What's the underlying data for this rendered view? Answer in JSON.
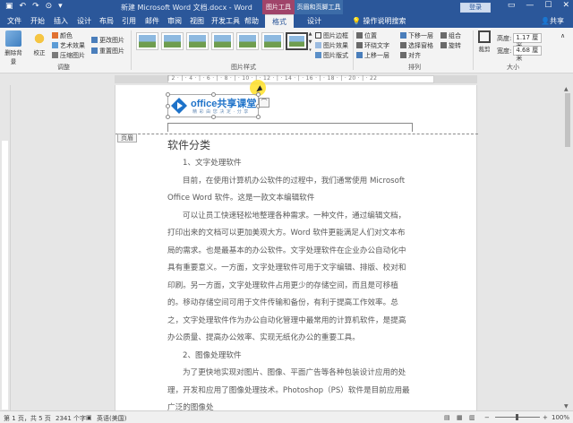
{
  "titlebar": {
    "doc_title": "新建 Microsoft Word 文档.docx - Word",
    "context_tab_1": "图片工具",
    "context_tab_2": "页眉和页脚工具",
    "login_label": "登录"
  },
  "tabs": [
    {
      "label": "文件"
    },
    {
      "label": "开始"
    },
    {
      "label": "插入"
    },
    {
      "label": "设计"
    },
    {
      "label": "布局"
    },
    {
      "label": "引用"
    },
    {
      "label": "邮件"
    },
    {
      "label": "审阅"
    },
    {
      "label": "视图"
    },
    {
      "label": "开发工具"
    },
    {
      "label": "帮助"
    },
    {
      "label": "格式"
    },
    {
      "label": "设计"
    }
  ],
  "tellme": "操作说明搜索",
  "share": "共享",
  "ribbon": {
    "remove_bg": "删除背景",
    "corrections": "校正",
    "color": "颜色",
    "artistic": "艺术效果",
    "compress": "压缩图片",
    "change_pic": "更改图片",
    "reset_pic": "重置图片",
    "group_adjust": "调整",
    "group_styles": "图片样式",
    "pic_border": "图片边框",
    "pic_effects": "图片效果",
    "pic_layout": "图片版式",
    "position": "位置",
    "wrap_text": "环绕文字",
    "bring_forward": "上移一层",
    "send_backward": "下移一层",
    "selection_pane": "选择窗格",
    "align": "对齐",
    "group_obj": "组合",
    "rotate": "旋转",
    "group_arrange": "排列",
    "crop": "裁剪",
    "height_label": "高度:",
    "height_value": "1.17 厘米",
    "width_label": "宽度:",
    "width_value": "4.68 厘米",
    "group_size": "大小"
  },
  "document": {
    "header_tag": "页眉",
    "logo_text": "office共享课堂",
    "logo_sub": "精 彩 由 您 决 定 · 分 享",
    "heading": "软件分类",
    "sub1": "1、文字处理软件",
    "p1": "目前，在使用计算机办公软件的过程中，我们通常使用 Microsoft Office Word 软件。这是一款文本编辑软件",
    "p2": "可以让员工快速轻松地整理各种需求。一种文件，通过编辑文档，打印出来的文档可以更加美观大方。Word 软件更能满足人们对文本布局的需求。也是最基本的办公软件。文字处理软件在企业办公自动化中具有重要意义。一方面，文字处理软件可用于文字编辑、排版、校对和印刷。另一方面，文字处理软件占用更少的存储空间，而且是可移植的。移动存储空间可用于文件传输和备份，有利于提高工作效率。总之，文字处理软件作为办公自动化管理中最常用的计算机软件，是提高办公质量、提高办公效率、实现无纸化办公的重要工具。",
    "sub2": "2、图像处理软件",
    "p3": "为了更快地实现对图片、图像、平面广告等各种包装设计应用的处理，开发和应用了图像处理技术。Photoshop（PS）软件是目前应用最广泛的图像处"
  },
  "statusbar": {
    "pages": "第 1 页，共 5 页",
    "words": "2341 个字",
    "lang": "英语(美国)",
    "zoom": "100%"
  },
  "colors": {
    "word_blue": "#2b579a",
    "logo_blue": "#1d72c9",
    "cursor_highlight": "#ffe128"
  }
}
